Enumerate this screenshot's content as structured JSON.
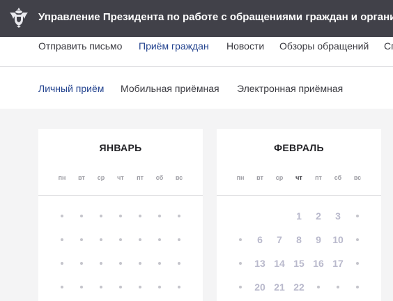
{
  "header": {
    "title": "Управление Президента по работе с обращениями граждан и организаций"
  },
  "main_nav": {
    "items": [
      {
        "label": "Отправить письмо",
        "active": false
      },
      {
        "label": "Приём граждан",
        "active": true
      },
      {
        "label": "Новости",
        "active": false
      },
      {
        "label": "Обзоры обращений",
        "active": false
      },
      {
        "label": "Сп",
        "active": false
      }
    ]
  },
  "sub_nav": {
    "items": [
      {
        "label": "Личный приём",
        "active": true
      },
      {
        "label": "Мобильная приёмная",
        "active": false
      },
      {
        "label": "Электронная приёмная",
        "active": false
      }
    ]
  },
  "calendar": {
    "weekdays": [
      "пн",
      "вт",
      "ср",
      "чт",
      "пт",
      "сб",
      "вс"
    ],
    "months": [
      {
        "name": "ЯНВАРЬ",
        "today_weekday": null,
        "rows": [
          [
            null,
            null,
            null,
            null,
            null,
            null,
            null
          ],
          [
            null,
            null,
            null,
            null,
            null,
            null,
            null
          ],
          [
            null,
            null,
            null,
            null,
            null,
            null,
            null
          ],
          [
            null,
            null,
            null,
            null,
            null,
            null,
            null
          ]
        ]
      },
      {
        "name": "ФЕВРАЛЬ",
        "today_weekday": 3,
        "rows": [
          [
            "",
            "",
            "",
            "1",
            "2",
            "3",
            null
          ],
          [
            null,
            "6",
            "7",
            "8",
            "9",
            "10",
            null
          ],
          [
            null,
            "13",
            "14",
            "15",
            "16",
            "17",
            null
          ],
          [
            null,
            "20",
            "21",
            "22",
            null,
            null,
            null
          ]
        ]
      }
    ]
  },
  "colors": {
    "topbar": "#414149",
    "accent": "#23438f",
    "day_text": "#b9b9cc"
  }
}
